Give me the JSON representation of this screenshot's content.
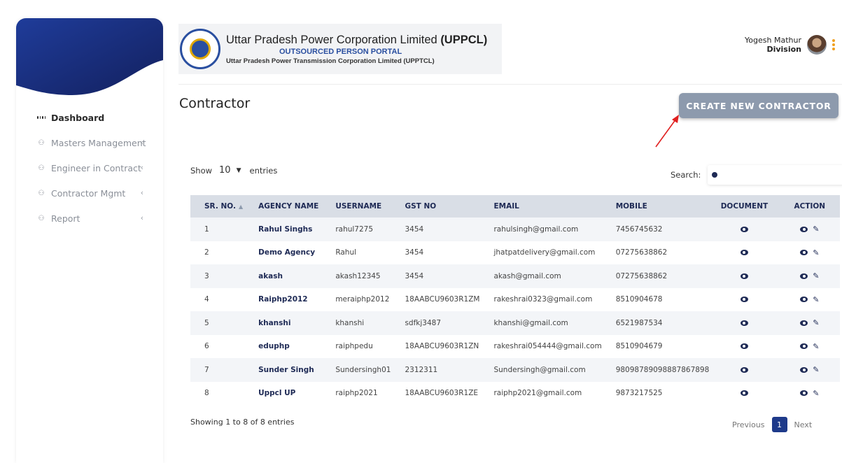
{
  "sidebar": {
    "items": [
      {
        "label": "Dashboard",
        "has_chevron": false,
        "active": true
      },
      {
        "label": "Masters Management",
        "has_chevron": true
      },
      {
        "label": "Engineer in Contract",
        "has_chevron": true
      },
      {
        "label": "Contractor Mgmt",
        "has_chevron": true
      },
      {
        "label": "Report",
        "has_chevron": true
      }
    ],
    "chevron": "‹"
  },
  "header": {
    "title_main": "Uttar Pradesh Power Corporation Limited ",
    "title_bold": "(UPPCL)",
    "subtitle": "OUTSOURCED PERSON PORTAL",
    "subtitle2": "Uttar Pradesh Power Transmission Corporation Limited (UPPTCL)"
  },
  "user": {
    "name": "Yogesh Mathur",
    "role": "Division"
  },
  "page": {
    "title": "Contractor",
    "create_button": "CREATE NEW CONTRACTOR"
  },
  "table_controls": {
    "show_label": "Show",
    "entries_value": "10",
    "entries_label": "entries",
    "search_label": "Search:"
  },
  "table": {
    "headers": [
      "SR. NO.",
      "AGENCY NAME",
      "USERNAME",
      "GST NO",
      "EMAIL",
      "MOBILE",
      "DOCUMENT",
      "ACTION"
    ],
    "rows": [
      [
        "1",
        "Rahul Singhs",
        "rahul7275",
        "3454",
        "rahulsingh@gmail.com",
        "7456745632"
      ],
      [
        "2",
        "Demo Agency",
        "Rahul",
        "3454",
        "jhatpatdelivery@gmail.com",
        "07275638862"
      ],
      [
        "3",
        "akash",
        "akash12345",
        "3454",
        "akash@gmail.com",
        "07275638862"
      ],
      [
        "4",
        "Raiphp2012",
        "meraiphp2012",
        "18AABCU9603R1ZM",
        "rakeshrai0323@gmail.com",
        "8510904678"
      ],
      [
        "5",
        "khanshi",
        "khanshi",
        "sdfkj3487",
        "khanshi@gmail.com",
        "6521987534"
      ],
      [
        "6",
        "eduphp",
        "raiphpedu",
        "18AABCU9603R1ZN",
        "rakeshrai054444@gmail.com",
        "8510904679"
      ],
      [
        "7",
        "Sunder Singh",
        "Sundersingh01",
        "2312311",
        "Sundersingh@gmail.com",
        "98098789098887867898"
      ],
      [
        "8",
        "Uppcl UP",
        "raiphp2021",
        "18AABCU9603R1ZE",
        "raiphp2021@gmail.com",
        "9873217525"
      ]
    ]
  },
  "footer": {
    "info": "Showing 1 to 8 of 8 entries",
    "previous": "Previous",
    "page": "1",
    "next": "Next"
  },
  "colors": {
    "sidebar_wave": "#1e2a6e",
    "accent": "#1e3a8a",
    "button": "#8d9aad",
    "kebab": "#f0a020",
    "arrow": "#e02020"
  },
  "icons": [
    "grid-icon",
    "users-icon",
    "chevron-left-icon",
    "eye-icon",
    "pencil-icon",
    "search-icon",
    "kebab-menu-icon",
    "sort-up-icon"
  ]
}
